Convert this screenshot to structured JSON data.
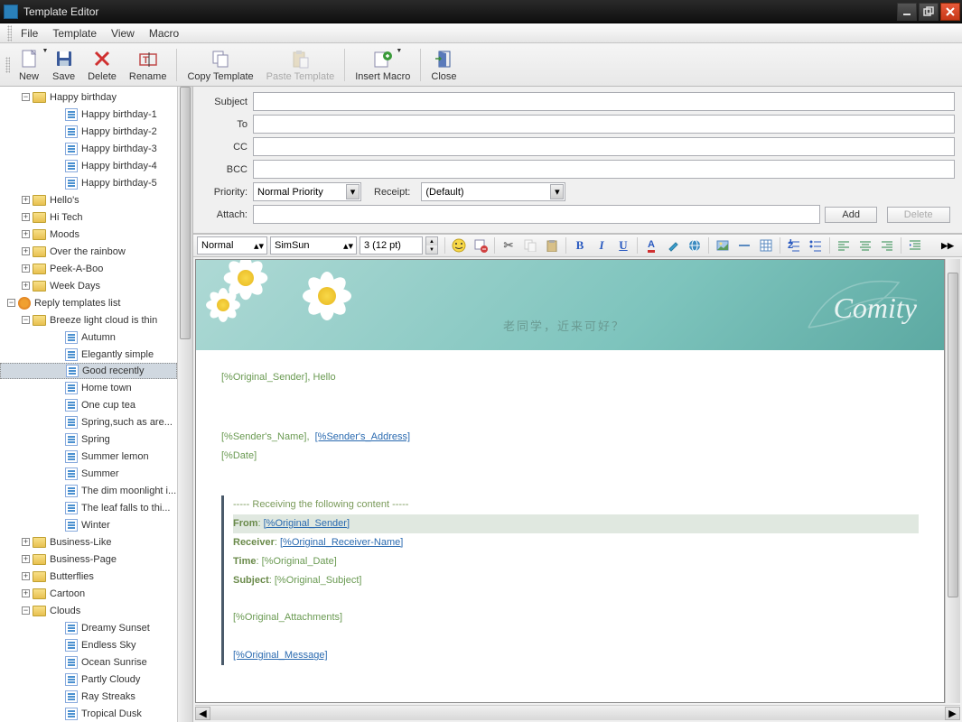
{
  "window": {
    "title": "Template Editor"
  },
  "menu": {
    "file": "File",
    "template": "Template",
    "view": "View",
    "macro": "Macro"
  },
  "toolbar": {
    "new": "New",
    "save": "Save",
    "delete": "Delete",
    "rename": "Rename",
    "copy_template": "Copy Template",
    "paste_template": "Paste Template",
    "insert_macro": "Insert Macro",
    "close": "Close"
  },
  "tree": {
    "happy_birthday": "Happy birthday",
    "hb_items": [
      "Happy birthday-1",
      "Happy birthday-2",
      "Happy birthday-3",
      "Happy birthday-4",
      "Happy birthday-5"
    ],
    "hellos": "Hello's",
    "hitech": "Hi Tech",
    "moods": "Moods",
    "rainbow": "Over the rainbow",
    "peekaboo": "Peek-A-Boo",
    "weekdays": "Week Days",
    "reply_list": "Reply templates list",
    "breeze": "Breeze light cloud is thin",
    "breeze_items": [
      "Autumn",
      "Elegantly simple",
      "Good recently",
      "Home town",
      "One cup tea",
      "Spring,such as are...",
      "Spring",
      "Summer lemon",
      "Summer",
      "The dim moonlight i...",
      "The leaf falls to thi...",
      "Winter"
    ],
    "business_like": "Business-Like",
    "business_page": "Business-Page",
    "butterflies": "Butterflies",
    "cartoon": "Cartoon",
    "clouds": "Clouds",
    "clouds_items": [
      "Dreamy Sunset",
      "Endless Sky",
      "Ocean Sunrise",
      "Partly Cloudy",
      "Ray Streaks",
      "Tropical Dusk"
    ],
    "selected_index": 2
  },
  "form": {
    "subject": "Subject",
    "to": "To",
    "cc": "CC",
    "bcc": "BCC",
    "priority": "Priority:",
    "priority_value": "Normal Priority",
    "receipt": "Receipt:",
    "receipt_value": "(Default)",
    "attach": "Attach:",
    "add": "Add",
    "delete": "Delete"
  },
  "format": {
    "style": "Normal",
    "font": "SimSun",
    "size": "3  (12 pt)"
  },
  "banner": {
    "greeting": "老同学，近来可好？",
    "brand": "Comity"
  },
  "email": {
    "line1_macro": "[%Original_Sender]",
    "line1_text": ", Hello",
    "sender_name": "[%Sender's_Name]",
    "sender_addr": "[%Sender's_Address]",
    "date": "[%Date]",
    "recv_header": "----- Receiving the following content -----",
    "from": "From",
    "from_val": "[%Original_Sender]",
    "receiver": "Receiver",
    "receiver_val": "[%Original_Receiver-Name]",
    "time": "Time",
    "time_val": "[%Original_Date]",
    "subject": "Subject",
    "subject_val": "[%Original_Subject]",
    "attachments": "[%Original_Attachments]",
    "message": "[%Original_Message]"
  }
}
